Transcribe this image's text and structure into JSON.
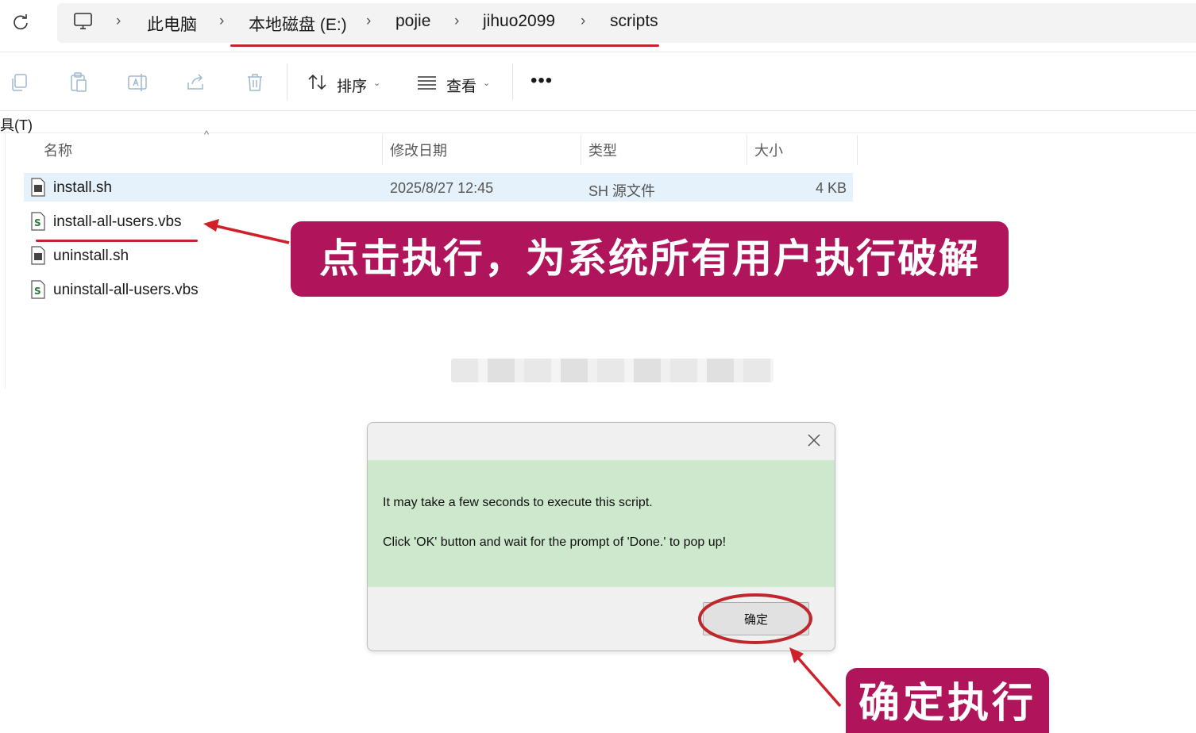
{
  "breadcrumb": {
    "items": [
      "此电脑",
      "本地磁盘 (E:)",
      "pojie",
      "jihuo2099",
      "scripts"
    ]
  },
  "toolbar": {
    "sort_label": "排序",
    "view_label": "查看",
    "more_label": "•••"
  },
  "menu": {
    "tools_label": "工具(T)"
  },
  "file_list": {
    "columns": [
      "名称",
      "修改日期",
      "类型",
      "大小"
    ],
    "rows": [
      {
        "name": "install.sh",
        "date": "2025/8/27 12:45",
        "type": "SH 源文件",
        "size": "4 KB",
        "icon": "sh-file-icon"
      },
      {
        "name": "install-all-users.vbs",
        "date": "",
        "type": "",
        "size": "",
        "icon": "vbs-script-icon"
      },
      {
        "name": "uninstall.sh",
        "date": "",
        "type": "",
        "size": "",
        "icon": "sh-file-icon"
      },
      {
        "name": "uninstall-all-users.vbs",
        "date": "",
        "type": "",
        "size": "",
        "icon": "vbs-script-icon"
      }
    ]
  },
  "annotations": {
    "banner_top": "点击执行，为系统所有用户执行破解",
    "banner_bottom": "确定执行",
    "accent_color": "#b0145a",
    "marker_color": "#c0272d"
  },
  "dialog": {
    "message_line1": "It may take a few seconds to execute this script.",
    "message_line2": "Click 'OK' button and wait for the prompt of 'Done.' to pop up!",
    "ok_label": "确定"
  }
}
